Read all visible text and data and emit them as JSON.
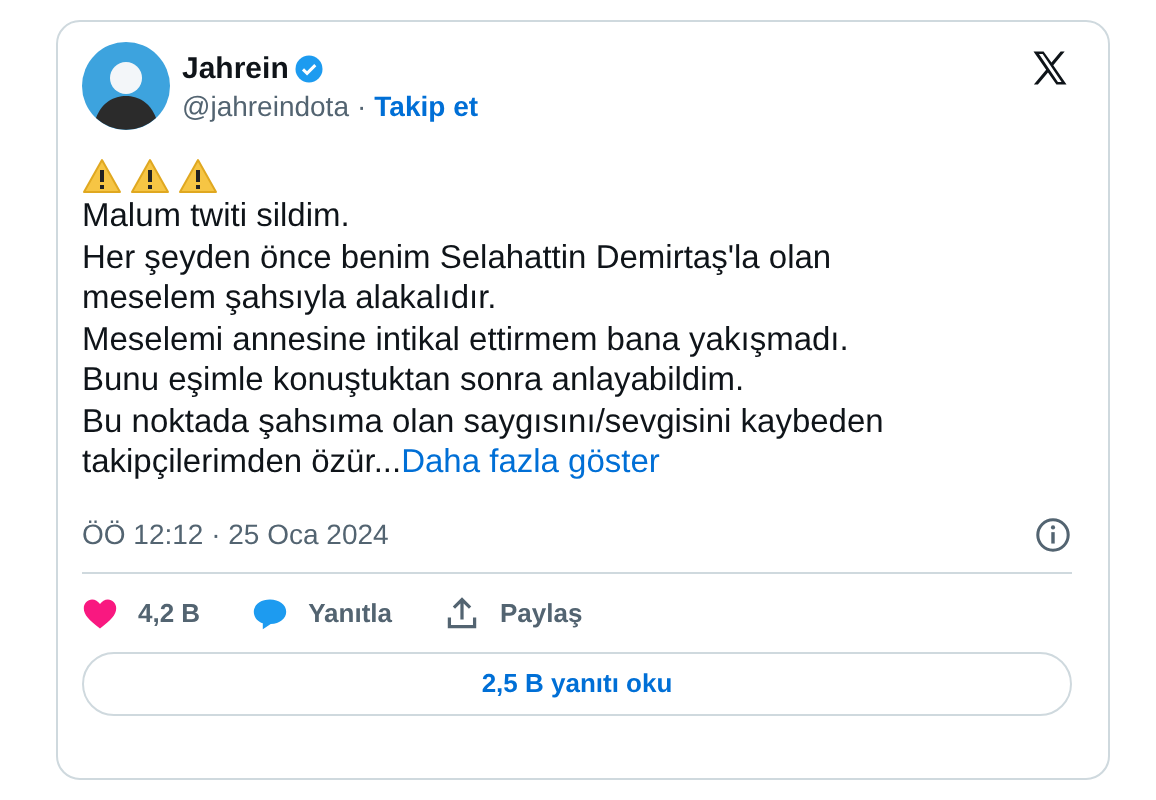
{
  "author": {
    "name": "Jahrein",
    "handle": "@jahreindota",
    "separator": "·",
    "follow": "Takip et"
  },
  "body": {
    "lines": [
      "Malum twiti sildim.",
      "Her şeyden önce benim Selahattin Demirtaş'la olan",
      "meselem şahsıyla alakalıdır.",
      "Meselemi annesine intikal ettirmem bana yakışmadı.",
      "Bunu eşimle konuştuktan sonra anlayabildim.",
      "Bu noktada şahsıma olan saygısını/sevgisini kaybeden",
      "takipçilerimden özür..."
    ],
    "more_link": "Daha fazla göster"
  },
  "timestamp": "ÖÖ 12:12 · 25 Oca 2024",
  "actions": [
    {
      "kind": "like",
      "label": "4,2 B"
    },
    {
      "kind": "reply",
      "label": "Yanıtla"
    },
    {
      "kind": "share",
      "label": "Paylaş"
    }
  ],
  "read_replies": "2,5 B yanıtı oku"
}
